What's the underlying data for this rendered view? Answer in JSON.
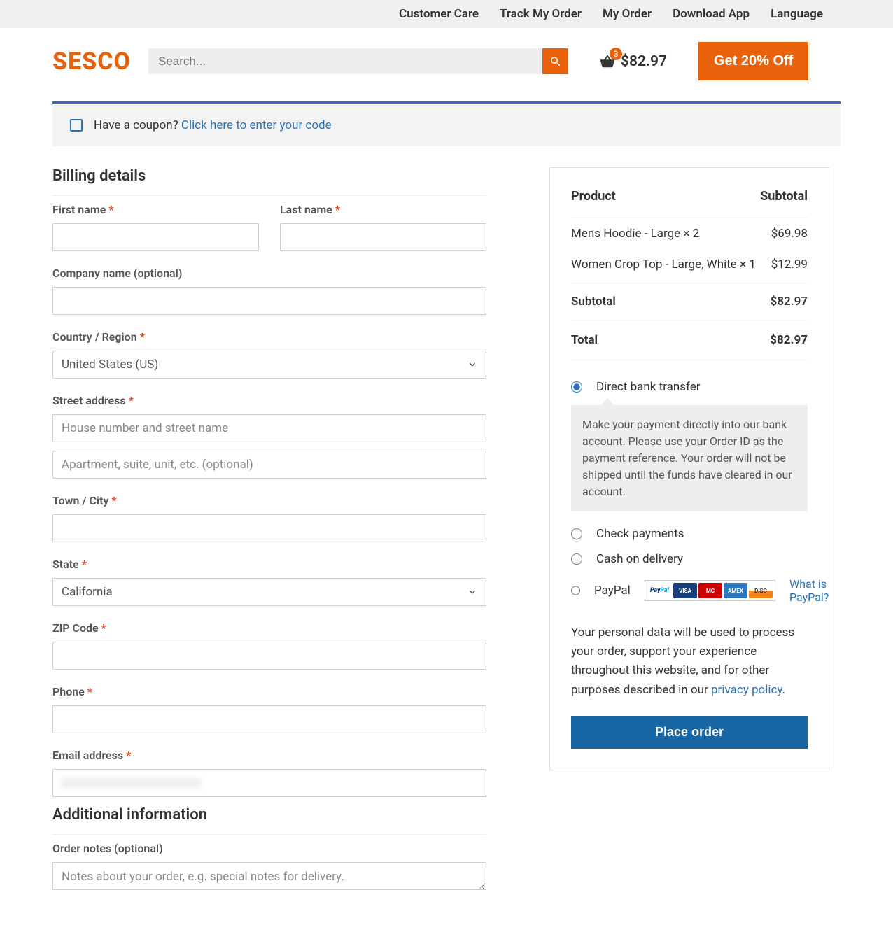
{
  "topbar": {
    "items": [
      "Customer Care",
      "Track My Order",
      "My Order",
      "Download App",
      "Language"
    ]
  },
  "header": {
    "logo": "SESCO",
    "search_placeholder": "Search...",
    "cart_count": "3",
    "cart_amount": "$82.97",
    "promo": "Get 20% Off"
  },
  "coupon": {
    "prompt": "Have a coupon? ",
    "link": "Click here to enter your code"
  },
  "billing": {
    "title": "Billing details",
    "first_name": "First name",
    "last_name": "Last name",
    "company": "Company name (optional)",
    "country": "Country / Region",
    "country_val": "United States (US)",
    "street": "Street address",
    "street_ph1": "House number and street name",
    "street_ph2": "Apartment, suite, unit, etc. (optional)",
    "city": "Town / City",
    "state": "State",
    "state_val": "California",
    "zip": "ZIP Code",
    "phone": "Phone",
    "email": "Email address"
  },
  "additional": {
    "title": "Additional information",
    "notes_label": "Order notes (optional)",
    "notes_ph": "Notes about your order, e.g. special notes for delivery."
  },
  "order": {
    "hdr_product": "Product",
    "hdr_subtotal": "Subtotal",
    "items": [
      {
        "name": "Mens Hoodie - Large × 2",
        "price": "$69.98"
      },
      {
        "name": "Women Crop Top - Large, White × 1",
        "price": "$12.99"
      }
    ],
    "subtotal_label": "Subtotal",
    "subtotal_val": "$82.97",
    "total_label": "Total",
    "total_val": "$82.97"
  },
  "payment": {
    "bank": "Direct bank transfer",
    "bank_desc": "Make your payment directly into our bank account. Please use your Order ID as the payment reference. Your order will not be shipped until the funds have cleared in our account.",
    "check": "Check payments",
    "cod": "Cash on delivery",
    "paypal": "PayPal",
    "what_pp": "What is PayPal?"
  },
  "privacy": {
    "text": "Your personal data will be used to process your order, support your experience throughout this website, and for other purposes described in our ",
    "link": "privacy policy"
  },
  "place_order": "Place order",
  "req": "*"
}
